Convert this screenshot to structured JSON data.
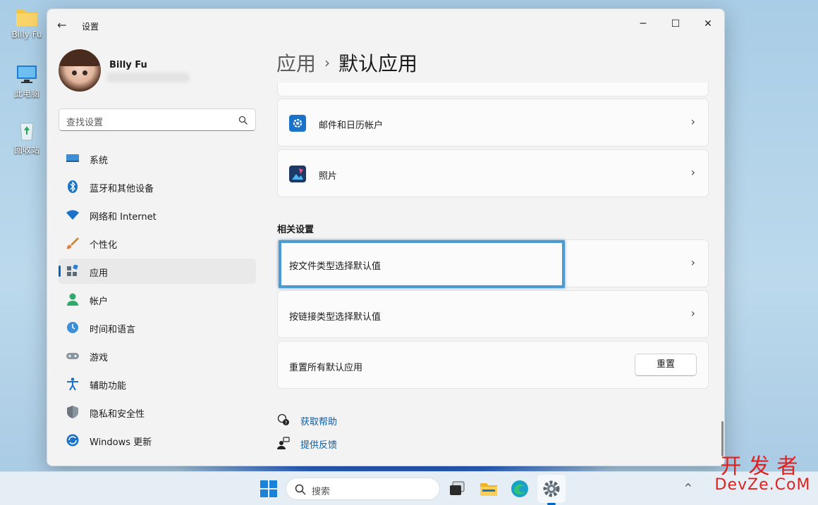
{
  "desktop": {
    "icons": [
      {
        "label": "Billy Fu",
        "icon": "folder-icon"
      },
      {
        "label": "此电脑",
        "icon": "computer-icon"
      },
      {
        "label": "回收站",
        "icon": "recycle-bin-icon"
      }
    ]
  },
  "window": {
    "title": "设置",
    "controls": {
      "minimize": "─",
      "maximize": "☐",
      "close": "✕"
    }
  },
  "user": {
    "name": "Billy Fu"
  },
  "search": {
    "placeholder": "查找设置"
  },
  "sidebar": {
    "items": [
      {
        "label": "系统",
        "icon": "system-icon"
      },
      {
        "label": "蓝牙和其他设备",
        "icon": "bluetooth-icon"
      },
      {
        "label": "网络和 Internet",
        "icon": "wifi-icon"
      },
      {
        "label": "个性化",
        "icon": "brush-icon"
      },
      {
        "label": "应用",
        "icon": "apps-icon",
        "active": true
      },
      {
        "label": "帐户",
        "icon": "account-icon"
      },
      {
        "label": "时间和语言",
        "icon": "time-language-icon"
      },
      {
        "label": "游戏",
        "icon": "gamepad-icon"
      },
      {
        "label": "辅助功能",
        "icon": "accessibility-icon"
      },
      {
        "label": "隐私和安全性",
        "icon": "shield-icon"
      },
      {
        "label": "Windows 更新",
        "icon": "update-icon"
      }
    ]
  },
  "breadcrumb": {
    "parent": "应用",
    "separator": "›",
    "current": "默认应用"
  },
  "apps": [
    {
      "label": "邮件和日历帐户",
      "icon": "gear-icon"
    },
    {
      "label": "照片",
      "icon": "photos-icon"
    }
  ],
  "related": {
    "title": "相关设置",
    "items": [
      {
        "label": "按文件类型选择默认值"
      },
      {
        "label": "按链接类型选择默认值"
      }
    ],
    "reset": {
      "label": "重置所有默认应用",
      "button": "重置"
    }
  },
  "links": {
    "help": "获取帮助",
    "feedback": "提供反馈"
  },
  "taskbar": {
    "search_placeholder": "搜索"
  },
  "watermark": {
    "line1": "开发者",
    "line2": "DevZe.CoM"
  },
  "colors": {
    "accent": "#0067c0",
    "highlight_border": "#4d9ad3",
    "link": "#0a5ea8"
  }
}
